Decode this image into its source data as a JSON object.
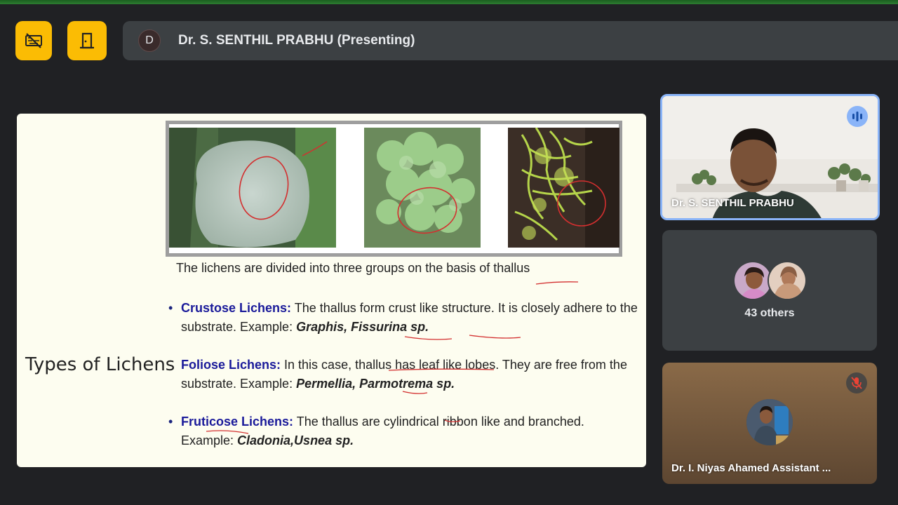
{
  "meeting": {
    "presenter_initial": "D",
    "presenter_label": "Dr. S. SENTHIL PRABHU (Presenting)",
    "accent": "#fbbc04"
  },
  "toolbar": {
    "icons": [
      "no-video-icon",
      "exit-door-icon"
    ]
  },
  "slide": {
    "title": "Types of Lichens",
    "caption": "The lichens are divided into three groups on the basis of thallus",
    "types": [
      {
        "name": "Crustose Lichens:",
        "desc": " The thallus form crust like structure. It is closely adhere to the substrate. Example: ",
        "example": "Graphis, Fissurina sp."
      },
      {
        "name": "Foliose Lichens:",
        "desc": " In this case, thallus has leaf like lobes. They are free from the substrate. Example: ",
        "example": "Permellia, Parmotrema sp."
      },
      {
        "name": "Fruticose Lichens:",
        "desc": " The thallus are cylindrical ribbon like and branched. Example: ",
        "example": "Cladonia,Usnea sp."
      }
    ]
  },
  "participants": {
    "presenter_tile_name": "Dr. S. SENTHIL PRABHU",
    "others_label": "43 others",
    "niyas_tile_name": "Dr. I. Niyas Ahamed Assistant ..."
  }
}
